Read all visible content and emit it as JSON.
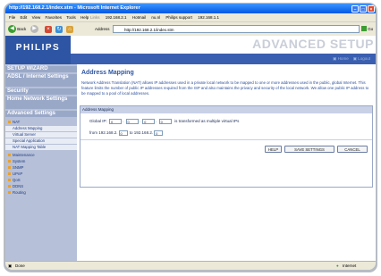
{
  "window": {
    "title": "http://192.168.2.1/index.stm - Microsoft Internet Explorer",
    "minimize": "–",
    "maximize": "□",
    "close": "×"
  },
  "menubar": {
    "items": [
      "File",
      "Edit",
      "View",
      "Favorites",
      "Tools",
      "Help"
    ],
    "links_label": "Links",
    "links": [
      "192.168.2.1",
      "Hotmail",
      "nu.nl",
      "Philips support",
      "192.168.1.1"
    ]
  },
  "toolbar": {
    "back_label": "Back",
    "address_label": "Address",
    "address_value": "http://192.168.2.1/index.stm",
    "go_label": "Go"
  },
  "header": {
    "logo": "PHILIPS",
    "banner": "ADVANCED SETUP",
    "home_link": "Home",
    "logout_link": "Logout"
  },
  "sidebar": {
    "sections": [
      "SETUP WIZARD",
      "ADSL / Internet Settings",
      "Security",
      "Home Network Settings",
      "Advanced Settings"
    ],
    "nat": "NAT",
    "nat_items": [
      "Address Mapping",
      "Virtual Server",
      "Special Application",
      "NAT Mapping Table"
    ],
    "items": [
      "Maintenance",
      "System",
      "SNMP",
      "UPnP",
      "QoS",
      "DDNS",
      "Routing"
    ]
  },
  "main": {
    "title": "Address Mapping",
    "description": "Network Address Translation (NAT) allows IP addresses used in a private local network to be mapped to one or more addresses used in the public, global Internet. This feature limits the number of public IP addresses required from the ISP and also maintains the privacy and security of the local network. We allow one public IP address to be mapped to a pool of local addresses.",
    "panel_title": "Address Mapping",
    "global_ip_label": "Global IP:",
    "global_ip": [
      "0",
      "0",
      "0",
      "0"
    ],
    "global_ip_suffix": "is transformed as multiple virtual IPs",
    "from_label": "from 192.168.2.",
    "from_value": "0",
    "to_label": "to 192.168.2.",
    "to_value": "0",
    "help_button": "HELP",
    "save_button": "SAVE SETTINGS",
    "cancel_button": "CANCEL"
  },
  "status": {
    "left": "Done",
    "zone": "Internet"
  }
}
